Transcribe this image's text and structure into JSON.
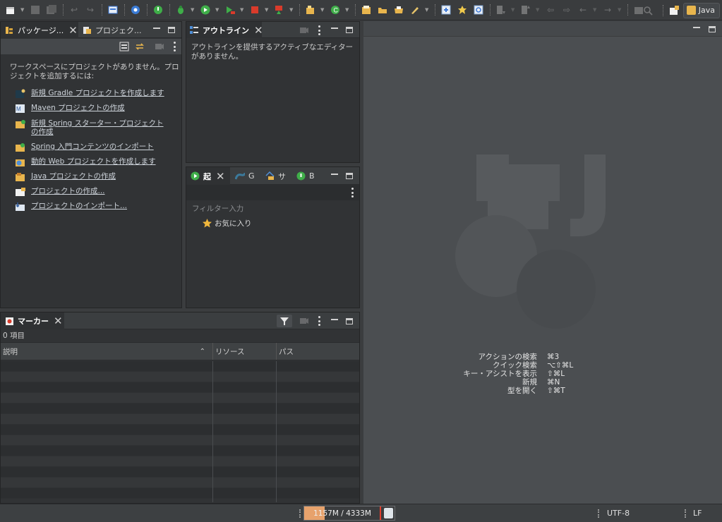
{
  "toolbar": {
    "icons": [
      "new-icon",
      "save-icon",
      "save-all-icon",
      "undo-icon",
      "redo-icon",
      "terminal-icon",
      "gear-icon",
      "spring-boot-icon",
      "debug-icon",
      "run-icon",
      "coverage-icon",
      "stop-icon",
      "external-tools-icon",
      "new-java-package-icon",
      "new-java-class-icon",
      "open-type-icon",
      "open-folder-icon",
      "open-task-icon",
      "pen-icon",
      "toggle-breadcrumb-icon",
      "mark-occurrences-icon",
      "refresh-icon",
      "next-annotation-icon",
      "prev-annotation-icon",
      "last-edit-location-icon",
      "forward-location-icon",
      "back-icon",
      "forward-icon",
      "pin-editor-icon",
      "search-icon",
      "open-perspective-icon"
    ],
    "perspective_label": "Java"
  },
  "package_explorer": {
    "tabs": [
      {
        "label": "パッケージ..."
      },
      {
        "label": "プロジェク..."
      }
    ],
    "message": "ワークスペースにプロジェクトがありません。プロジェクトを追加するには:",
    "links": [
      {
        "label": "新規 Gradle プロジェクトを作成します",
        "icon": "gradle-project-icon"
      },
      {
        "label": "Maven プロジェクトの作成",
        "icon": "maven-project-icon"
      },
      {
        "label": "新規 Spring スターター・プロジェクトの作成",
        "icon": "spring-starter-icon"
      },
      {
        "label": "Spring 入門コンテンツのインポート",
        "icon": "spring-import-icon"
      },
      {
        "label": "動的 Web プロジェクトを作成します",
        "icon": "web-project-icon"
      },
      {
        "label": "Java プロジェクトの作成",
        "icon": "java-project-icon"
      },
      {
        "label": "プロジェクトの作成...",
        "icon": "new-project-icon"
      },
      {
        "label": "プロジェクトのインポート...",
        "icon": "import-project-icon"
      }
    ]
  },
  "outline": {
    "tab_label": "アウトライン",
    "message": "アウトラインを提供するアクティブなエディターがありません。"
  },
  "boot_dashboard": {
    "tabs": [
      {
        "label": "起"
      },
      {
        "label": "G"
      },
      {
        "label": "サ"
      },
      {
        "label": "B"
      }
    ],
    "filter_placeholder": "フィルター入力",
    "favorites_label": "お気に入り"
  },
  "markers": {
    "tab_label": "マーカー",
    "count": "0 項目",
    "columns": [
      {
        "label": "説明"
      },
      {
        "label": "リソース"
      },
      {
        "label": "パス"
      }
    ],
    "rows": 13
  },
  "editor": {
    "shortcuts": [
      {
        "action": "アクションの検索",
        "keys": "⌘3"
      },
      {
        "action": "クイック検索",
        "keys": "⌥⇧⌘L"
      },
      {
        "action": "キー・アシストを表示",
        "keys": "⇧⌘L"
      },
      {
        "action": "新規",
        "keys": "⌘N"
      },
      {
        "action": "型を開く",
        "keys": "⇧⌘T"
      }
    ]
  },
  "status": {
    "heap": "1157M / 4333M",
    "heap_used_fraction": 0.267,
    "encoding": "UTF-8",
    "line_delimiter": "LF"
  },
  "colors": {
    "accent_green": "#3fae49",
    "accent_orange": "#e7a26c",
    "accent_red": "#e0402f",
    "link_blue": "#4f8fd8"
  }
}
